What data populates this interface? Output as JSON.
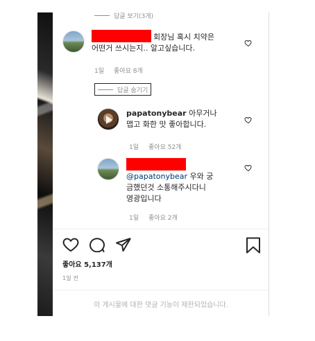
{
  "collapsed_replies_label": "답글 보기(3개)",
  "comments": [
    {
      "username_redacted": true,
      "text_line1": "회장님 혹시 치약은",
      "text_line2": "어떤거 쓰시는지.. 알고싶습니다.",
      "time": "1일",
      "likes": "좋아요 8개"
    }
  ],
  "hide_replies_label": "답글 숨기기",
  "replies": [
    {
      "username": "papatonybear",
      "text_line1": "아무거나",
      "text_line2": "맵고 화한 맛 좋아합니다.",
      "time": "1일",
      "likes": "좋아요 52개"
    },
    {
      "username_redacted": true,
      "mention": "@papatonybear",
      "text_line1": "우와 궁",
      "text_line2": "금했던것 소통해주시다니",
      "text_line3": "영광입니다",
      "time": "1일",
      "likes": "좋아요 2개"
    }
  ],
  "post": {
    "likes": "좋아요 5,137개",
    "posted": "1일 전",
    "comments_disabled": "이 게시물에 대한 댓글 기능이 제한되었습니다."
  },
  "icons": [
    "heart-icon",
    "comment-icon",
    "share-icon",
    "bookmark-icon"
  ]
}
